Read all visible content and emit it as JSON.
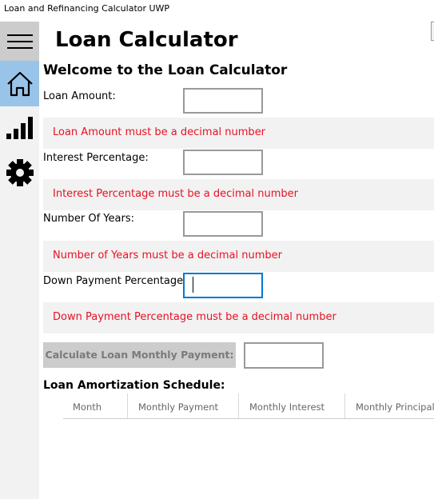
{
  "window": {
    "title": "Loan and Refinancing Calculator UWP"
  },
  "sidebar": {
    "items": [
      {
        "name": "menu",
        "icon": "hamburger-icon"
      },
      {
        "name": "home",
        "icon": "home-icon",
        "selected": true
      },
      {
        "name": "statistics",
        "icon": "signal-bars-icon"
      },
      {
        "name": "settings",
        "icon": "gear-icon"
      }
    ]
  },
  "page": {
    "title": "Loan Calculator",
    "welcome": "Welcome to the Loan Calculator"
  },
  "form": {
    "fields": [
      {
        "label": "Loan Amount:",
        "value": "",
        "error": "Loan Amount must be a decimal number"
      },
      {
        "label": "Interest Percentage:",
        "value": "",
        "error": "Interest Percentage must be a decimal number"
      },
      {
        "label": "Number Of Years:",
        "value": "",
        "error": "Number of Years must be a decimal number"
      },
      {
        "label": "Down Payment Percentage:",
        "value": "",
        "error": "Down Payment Percentage must be a decimal number",
        "focused": true
      }
    ],
    "calculate_button": "Calculate Loan Monthly Payment:",
    "monthly_payment_result": ""
  },
  "amortization": {
    "title": "Loan Amortization Schedule:",
    "columns": [
      "Month",
      "Monthly Payment",
      "Monthly Interest",
      "Monthly Principal"
    ],
    "rows": []
  },
  "colors": {
    "accent": "#0078d7",
    "selected_nav": "#99c4ea",
    "error_text": "#e81123",
    "error_band": "#f2f2f2"
  }
}
